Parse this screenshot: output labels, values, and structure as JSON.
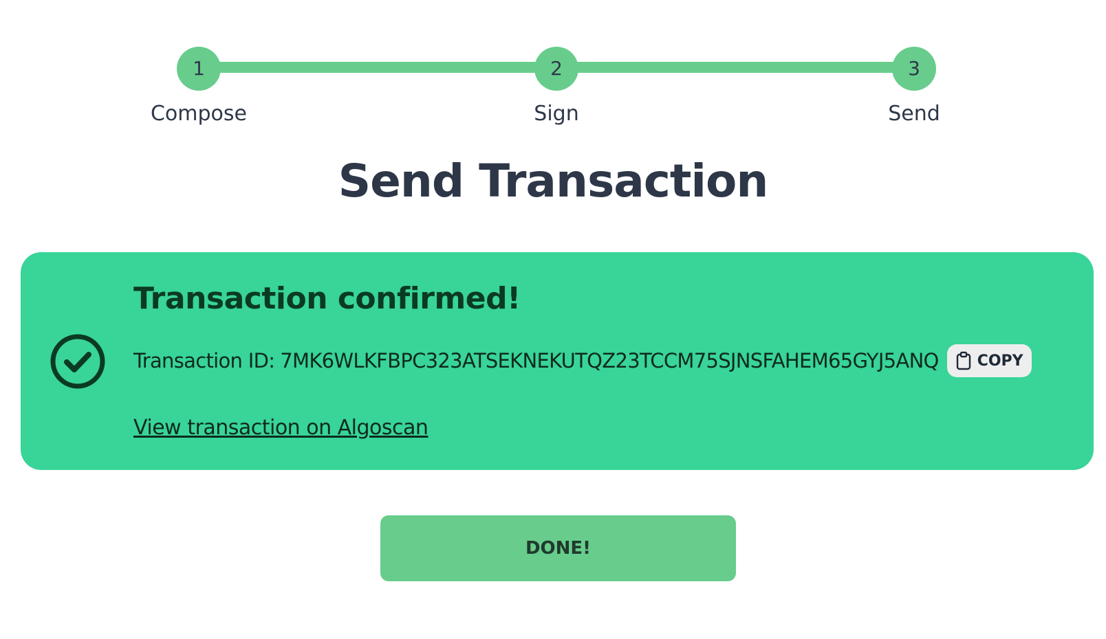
{
  "stepper": {
    "steps": [
      {
        "number": "1",
        "label": "Compose"
      },
      {
        "number": "2",
        "label": "Sign"
      },
      {
        "number": "3",
        "label": "Send"
      }
    ],
    "color": "#68cc8c"
  },
  "page": {
    "title": "Send Transaction"
  },
  "alert": {
    "heading": "Transaction confirmed!",
    "txid_label": "Transaction ID:",
    "txid_value": "7MK6WLKFBPC323ATSEKNEKUTQZ23TCCM75SJNSFAHEM65GYJ5ANQ",
    "copy_label": "COPY",
    "link_text": "View transaction on Algoscan",
    "background": "#38d498",
    "icon": "check-circle-icon"
  },
  "actions": {
    "done_label": "DONE!"
  }
}
